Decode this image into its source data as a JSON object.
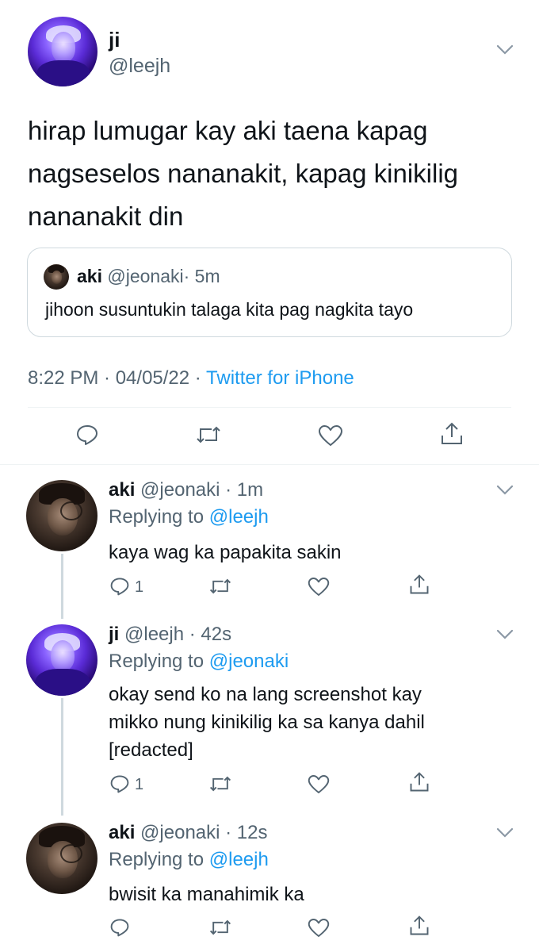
{
  "main_tweet": {
    "display_name": "ji",
    "handle": "@leejh",
    "text_lines": [
      "hirap lumugar kay aki taena kapag",
      "nagseselos nananakit, kapag kinikilig",
      "nananakit din"
    ],
    "quoted": {
      "display_name": "aki",
      "handle": "@jeonaki",
      "time": "· 5m",
      "text": "jihoon susuntukin talaga kita pag nagkita tayo"
    },
    "timestamp": "8:22 PM · 04/05/22 ·",
    "source": "Twitter for iPhone",
    "actions": {
      "reply_icon": "reply-icon",
      "retweet_icon": "retweet-icon",
      "like_icon": "like-icon",
      "share_icon": "share-icon"
    }
  },
  "replies": [
    {
      "display_name": "aki",
      "meta": "@jeonaki · 1m",
      "replying_prefix": "Replying to",
      "replying_to": "@leejh",
      "text_lines": [
        "kaya wag ka papakita sakin"
      ],
      "reply_count": "1"
    },
    {
      "display_name": "ji",
      "meta": "@leejh · 42s",
      "replying_prefix": "Replying to",
      "replying_to": "@jeonaki",
      "text_lines": [
        "okay send ko na lang screenshot kay",
        "mikko nung kinikilig ka sa kanya dahil",
        "[redacted]"
      ],
      "reply_count": "1"
    },
    {
      "display_name": "aki",
      "meta": "@jeonaki · 12s",
      "replying_prefix": "Replying to",
      "replying_to": "@leejh",
      "text_lines": [
        "bwisit ka manahimik ka"
      ],
      "reply_count": ""
    }
  ],
  "colors": {
    "link": "#1d9bf0",
    "muted": "#536471",
    "text": "#0f1419"
  }
}
